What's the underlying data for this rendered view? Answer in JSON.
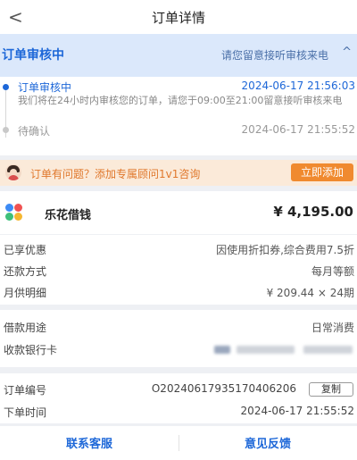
{
  "nav": {
    "back_glyph": "<",
    "title": "订单详情"
  },
  "status": {
    "title": "订单审核中",
    "hint": "请您留意接听审核来电",
    "chevron_glyph": "^",
    "accent_color": "#1d67d8"
  },
  "timeline": {
    "steps": [
      {
        "name": "订单审核中",
        "time": "2024-06-17 21:56:03",
        "desc": "我们将在24小时内审核您的订单，请您于09:00至21:00留意接听审核来电"
      },
      {
        "name": "待确认",
        "time": "2024-06-17 21:55:52"
      }
    ]
  },
  "banner": {
    "text": "订单有问题？添加专属顾问1v1咨询",
    "button": "立即添加",
    "accent_color": "#f08a2f"
  },
  "product": {
    "logo_icon": "four-dot-logo-icon",
    "name": "乐花借钱",
    "amount": "¥ 4,195.00"
  },
  "details": [
    {
      "label": "已享优惠",
      "value": "因使用折扣券,综合费用7.5折"
    },
    {
      "label": "还款方式",
      "value": "每月等额"
    },
    {
      "label": "月供明细",
      "value": "¥ 209.44 × 24期"
    }
  ],
  "usage": {
    "purpose_label": "借款用途",
    "purpose_value": "日常消费",
    "card_label": "收款银行卡"
  },
  "order": {
    "number_label": "订单编号",
    "number_value": "O20240617935170406206",
    "copy_button": "复制",
    "time_label": "下单时间",
    "time_value": "2024-06-17 21:55:52"
  },
  "footer": {
    "contact": "联系客服",
    "feedback": "意见反馈"
  }
}
